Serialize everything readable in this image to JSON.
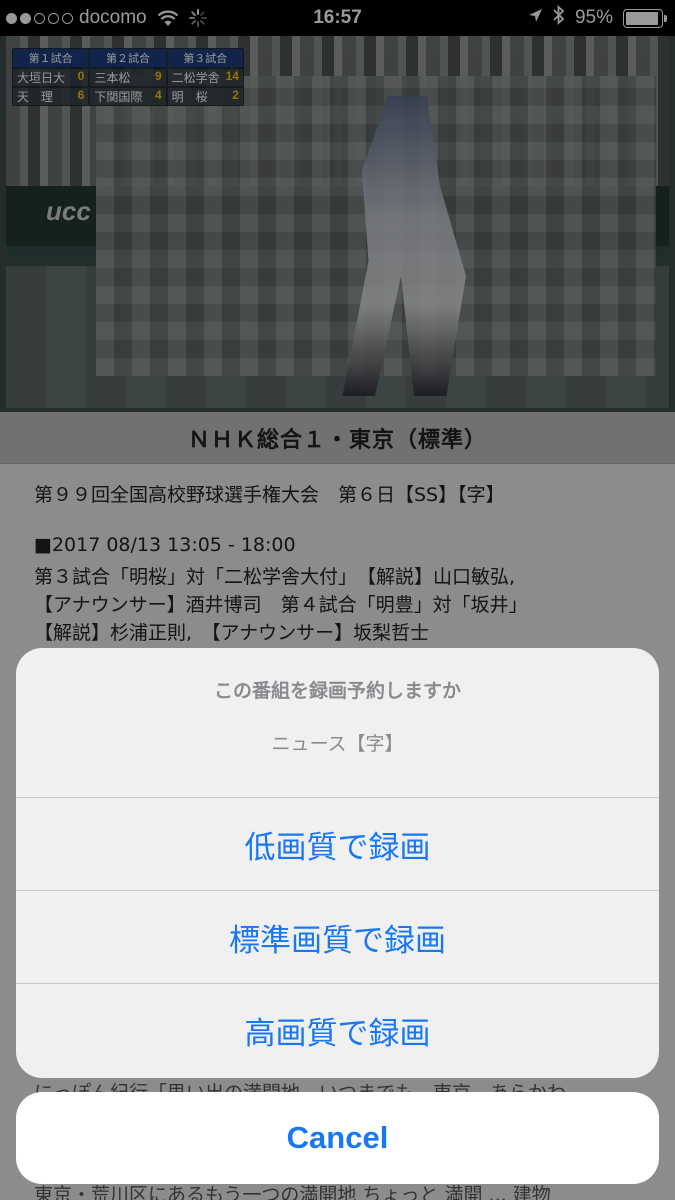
{
  "status_bar": {
    "carrier": "docomo",
    "time": "16:57",
    "battery_percent": "95%",
    "battery_level": 0.95,
    "signal_bars_filled": 2,
    "signal_bars_total": 5,
    "icons": [
      "wifi-icon",
      "loading-spinner-icon",
      "location-arrow-icon",
      "bluetooth-icon",
      "battery-icon"
    ]
  },
  "video": {
    "scoreboard": {
      "headers": [
        "第１試合",
        "第２試合",
        "第３試合"
      ],
      "rows": [
        [
          {
            "team": "大垣日大",
            "score": "0"
          },
          {
            "team": "三本松",
            "score": "9"
          },
          {
            "team": "二松学舎",
            "score": "14"
          }
        ],
        [
          {
            "team": "天　理",
            "score": "6"
          },
          {
            "team": "下関国際",
            "score": "4"
          },
          {
            "team": "明　桜",
            "score": "2"
          }
        ]
      ]
    },
    "sign_text": "ucc"
  },
  "channel": {
    "title": "ＮＨＫ総合１・東京（標準）"
  },
  "program": {
    "title": "第９９回全国高校野球選手権大会　第６日【SS】【字】",
    "datetime": "■2017 08/13 13:05 - 18:00",
    "description_lines": [
      "第３試合「明桜」対「二松学舎大付」　【解説】山口敏弘,",
      "【アナウンサー】酒井博司　第４試合「明豊」対「坂井」",
      "【解説】杉浦正則,　【アナウンサー】坂梨哲士"
    ],
    "obscured_lines": [
      "にっぽん紀行「思い出の満開地　いつまでも　東京　あらかわ",
      "東京・荒川区にあるもう一つの満開地 ちょっと 満開 ... 建物"
    ]
  },
  "action_sheet": {
    "title": "この番組を録画予約しますか",
    "subtitle": "ニュース【字】",
    "options": [
      "低画質で録画",
      "標準画質で録画",
      "高画質で録画"
    ],
    "cancel_label": "Cancel",
    "accent_color": "#1877f2"
  }
}
